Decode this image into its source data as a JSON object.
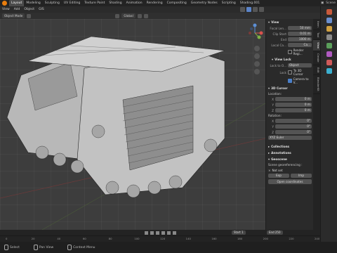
{
  "window": {
    "workspaces": [
      "Layout",
      "Modeling",
      "Sculpting",
      "UV Editing",
      "Texture Paint",
      "Shading",
      "Animation",
      "Rendering",
      "Compositing",
      "Geometry Nodes",
      "Scripting",
      "Shading.001"
    ],
    "scene_label": "Scene"
  },
  "menus": [
    "View",
    "Add",
    "Object",
    "GIS"
  ],
  "toolbar": {
    "selection_mode": "Object Mode",
    "orientation": "Global"
  },
  "npanel": {
    "view_header": "View",
    "focal_length": {
      "label": "Focal Len...",
      "value": "50 mm"
    },
    "clip_start": {
      "label": "Clip Start",
      "value": "0.01 m"
    },
    "clip_end": {
      "label": "End",
      "value": "1000 m"
    },
    "local_camera": {
      "label": "Local Ca...",
      "value": "Ca..."
    },
    "render_region": "Render Regi...",
    "view_lock_header": "View Lock",
    "lock_to_object": {
      "label": "Lock to O...",
      "value": "Object"
    },
    "lock_to_3d_cursor": "To 3D Cursor",
    "lock_label": "Lock",
    "camera_to_view": "Camera to V...",
    "cursor_header": "3D Cursor",
    "location_label": "Location:",
    "location": [
      {
        "axis": "X",
        "value": "0 m"
      },
      {
        "axis": "Y",
        "value": "0 m"
      },
      {
        "axis": "Z",
        "value": "0 m"
      }
    ],
    "rotation_label": "Rotation:",
    "rotation": [
      {
        "axis": "X",
        "value": "0°"
      },
      {
        "axis": "Y",
        "value": "0°"
      },
      {
        "axis": "Z",
        "value": "0°"
      }
    ],
    "rotation_mode": "XYZ Euler",
    "collections_header": "Collections",
    "annotations_header": "Annotations",
    "georeferencing_header": "Geoscene",
    "georef_text": "Scene georeferencing :",
    "georef_status": "Not set",
    "georef_buttons": [
      "Exp",
      "Imp"
    ],
    "open_coords_button": "Open coordinates"
  },
  "vertical_tabs": [
    "Item",
    "Tool",
    "View",
    "Create",
    "Edit",
    "BlenderKit"
  ],
  "right_strip": {
    "icon_colors": [
      "#c85a3c",
      "#6a8fd0",
      "#d0a040",
      "#8a8a8a",
      "#5a9e5a",
      "#b05ac0",
      "#d05a5a",
      "#3cb0d0"
    ]
  },
  "timeline": {
    "start_label": "Start",
    "start_value": "1",
    "end_label": "End",
    "end_value": "250",
    "ticks": [
      "0",
      "20",
      "40",
      "60",
      "80",
      "100",
      "120",
      "140",
      "160",
      "180",
      "200",
      "220",
      "240"
    ]
  },
  "statusbar": {
    "select": "Select",
    "rotate_view": "Pan View",
    "context_menu": "Context Menu"
  }
}
